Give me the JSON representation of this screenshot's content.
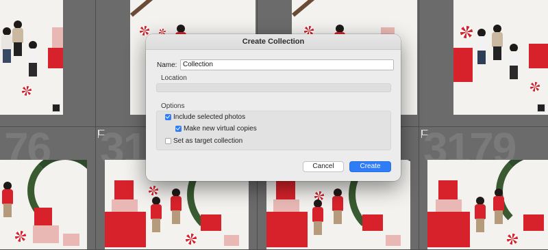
{
  "dialog": {
    "title": "Create Collection",
    "name_label": "Name:",
    "name_value": "Collection",
    "location_label": "Location",
    "options_label": "Options",
    "options": [
      {
        "label": "Include selected photos",
        "checked": true
      },
      {
        "label": "Make new virtual copies",
        "checked": true
      },
      {
        "label": "Set as target collection",
        "checked": false
      }
    ],
    "cancel_label": "Cancel",
    "create_label": "Create"
  },
  "grid": {
    "cell_numbers": [
      "76",
      "317",
      "3179"
    ]
  },
  "colors": {
    "accent": "#2e7cf6",
    "background": "#5f5f5f"
  }
}
